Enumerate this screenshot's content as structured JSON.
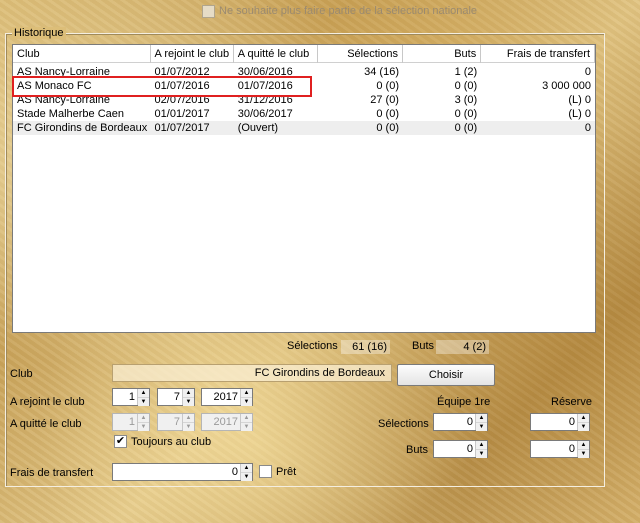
{
  "top_checkbox": {
    "label": "Ne souhaite plus faire partie de la sélection nationale",
    "checked": false
  },
  "history": {
    "title": "Historique",
    "columns": [
      "Club",
      "A rejoint le club",
      "A quitté le club",
      "Sélections",
      "Buts",
      "Frais de transfert"
    ],
    "rows": [
      [
        "AS Nancy-Lorraine",
        "01/07/2012",
        "30/06/2016",
        "34 (16)",
        "1 (2)",
        "0"
      ],
      [
        "AS Monaco FC",
        "01/07/2016",
        "01/07/2016",
        "0 (0)",
        "0 (0)",
        "3 000 000"
      ],
      [
        "AS Nancy-Lorraine",
        "02/07/2016",
        "31/12/2016",
        "27 (0)",
        "3 (0)",
        "(L) 0"
      ],
      [
        "Stade Malherbe Caen",
        "01/01/2017",
        "30/06/2017",
        "0 (0)",
        "0 (0)",
        "(L) 0"
      ],
      [
        "FC Girondins de Bordeaux",
        "01/07/2017",
        "(Ouvert)",
        "0 (0)",
        "0 (0)",
        "0"
      ]
    ]
  },
  "totals": {
    "selections_label": "Sélections",
    "selections_value": "61 (16)",
    "buts_label": "Buts",
    "buts_value": "4 (2)"
  },
  "form": {
    "club_label": "Club",
    "club_value": "FC Girondins de Bordeaux",
    "choose_button": "Choisir",
    "joined_label": "A rejoint le club",
    "joined_day": "1",
    "joined_month": "7",
    "joined_year": "2017",
    "left_label": "A quitté le club",
    "left_day": "1",
    "left_month": "7",
    "left_year": "2017",
    "always_label": "Toujours au club",
    "always_checked": true,
    "team_first_label": "Équipe 1re",
    "reserve_label": "Réserve",
    "selections_label": "Sélections",
    "selections_first": "0",
    "selections_reserve": "0",
    "buts_label": "Buts",
    "buts_first": "0",
    "buts_reserve": "0",
    "fee_label": "Frais de transfert",
    "fee_value": "0",
    "loan_label": "Prêt",
    "loan_checked": false
  }
}
